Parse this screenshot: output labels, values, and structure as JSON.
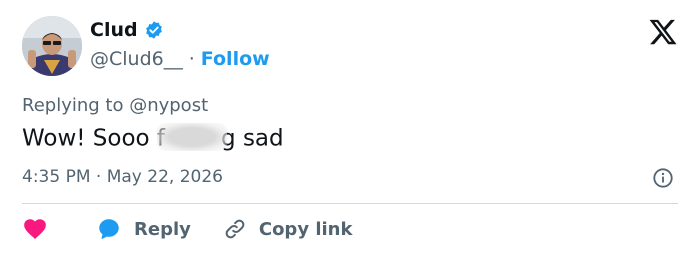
{
  "author": {
    "display_name": "Clud",
    "handle": "@Clud6__",
    "separator": "·",
    "follow_label": "Follow"
  },
  "tweet": {
    "reply_context": "Replying to @nypost",
    "text_before": "Wow! Sooo f",
    "text_after": "g sad",
    "timestamp": "4:35 PM · May 22, 2026"
  },
  "actions": {
    "reply_label": "Reply",
    "copy_link_label": "Copy link"
  },
  "colors": {
    "accent": "#1d9bf0",
    "like": "#f91880",
    "text_primary": "#0f1419",
    "text_secondary": "#536471",
    "divider": "#cfd9de"
  },
  "icons": {
    "verified": "verified-badge-icon",
    "platform": "x-logo-icon",
    "info": "info-icon",
    "like": "heart-icon",
    "reply": "speech-bubble-icon",
    "copy_link": "link-icon"
  }
}
